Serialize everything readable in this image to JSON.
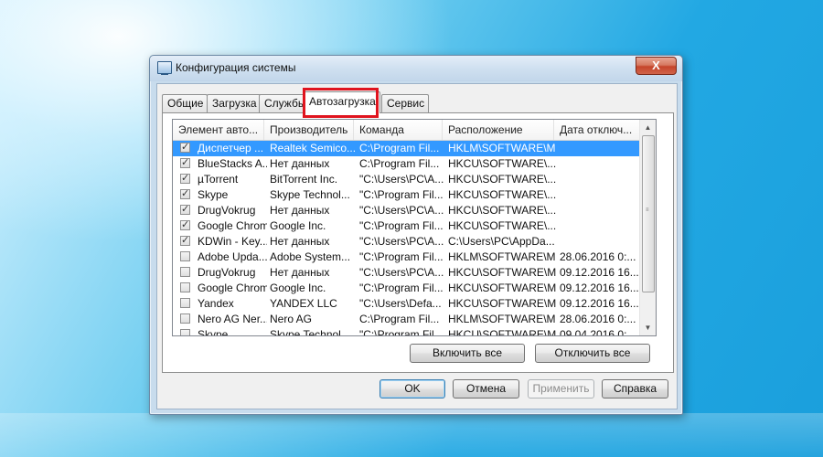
{
  "window": {
    "title": "Конфигурация системы",
    "close_label": "X"
  },
  "tabs": [
    {
      "label": "Общие",
      "active": false
    },
    {
      "label": "Загрузка",
      "active": false
    },
    {
      "label": "Службы",
      "active": false
    },
    {
      "label": "Автозагрузка",
      "active": true
    },
    {
      "label": "Сервис",
      "active": false
    }
  ],
  "highlight_color": "#e0141e",
  "list": {
    "columns": [
      "Элемент авто...",
      "Производитель",
      "Команда",
      "Расположение",
      "Дата отключ..."
    ],
    "rows": [
      {
        "checked": true,
        "selected": true,
        "cells": [
          "Диспетчер ...",
          "Realtek Semico...",
          "C:\\Program Fil...",
          "HKLM\\SOFTWARE\\M...",
          ""
        ]
      },
      {
        "checked": true,
        "selected": false,
        "cells": [
          "BlueStacks A...",
          "Нет данных",
          "C:\\Program Fil...",
          "HKCU\\SOFTWARE\\...",
          ""
        ]
      },
      {
        "checked": true,
        "selected": false,
        "cells": [
          "µTorrent",
          "BitTorrent Inc.",
          "\"C:\\Users\\PC\\A...",
          "HKCU\\SOFTWARE\\...",
          ""
        ]
      },
      {
        "checked": true,
        "selected": false,
        "cells": [
          "Skype",
          "Skype Technol...",
          "\"C:\\Program Fil...",
          "HKCU\\SOFTWARE\\...",
          ""
        ]
      },
      {
        "checked": true,
        "selected": false,
        "cells": [
          "DrugVokrug",
          "Нет данных",
          "\"C:\\Users\\PC\\A...",
          "HKCU\\SOFTWARE\\...",
          ""
        ]
      },
      {
        "checked": true,
        "selected": false,
        "cells": [
          "Google Chrome",
          "Google Inc.",
          "\"C:\\Program Fil...",
          "HKCU\\SOFTWARE\\...",
          ""
        ]
      },
      {
        "checked": true,
        "selected": false,
        "cells": [
          "KDWin - Key...",
          "Нет данных",
          "\"C:\\Users\\PC\\A...",
          "C:\\Users\\PC\\AppDa...",
          ""
        ]
      },
      {
        "checked": false,
        "selected": false,
        "cells": [
          "Adobe Upda...",
          "Adobe System...",
          "\"C:\\Program Fil...",
          "HKLM\\SOFTWARE\\M...",
          "28.06.2016 0:..."
        ]
      },
      {
        "checked": false,
        "selected": false,
        "cells": [
          "DrugVokrug",
          "Нет данных",
          "\"C:\\Users\\PC\\A...",
          "HKCU\\SOFTWARE\\M...",
          "09.12.2016 16..."
        ]
      },
      {
        "checked": false,
        "selected": false,
        "cells": [
          "Google Chrome",
          "Google Inc.",
          "\"C:\\Program Fil...",
          "HKCU\\SOFTWARE\\M...",
          "09.12.2016 16..."
        ]
      },
      {
        "checked": false,
        "selected": false,
        "cells": [
          "Yandex",
          "YANDEX LLC",
          "\"C:\\Users\\Defa...",
          "HKCU\\SOFTWARE\\M...",
          "09.12.2016 16..."
        ]
      },
      {
        "checked": false,
        "selected": false,
        "cells": [
          "Nero AG Ner...",
          "Nero AG",
          "C:\\Program Fil...",
          "HKLM\\SOFTWARE\\M...",
          "28.06.2016 0:..."
        ]
      },
      {
        "checked": false,
        "selected": false,
        "cells": [
          "Skype",
          "Skype Technol...",
          "\"C:\\Program Fil...",
          "HKCU\\SOFTWARE\\M...",
          "09.04.2016 0:..."
        ]
      }
    ]
  },
  "actions": {
    "enable_all": "Включить все",
    "disable_all": "Отключить все"
  },
  "footer": {
    "ok": "OK",
    "cancel": "Отмена",
    "apply": "Применить",
    "help": "Справка"
  }
}
